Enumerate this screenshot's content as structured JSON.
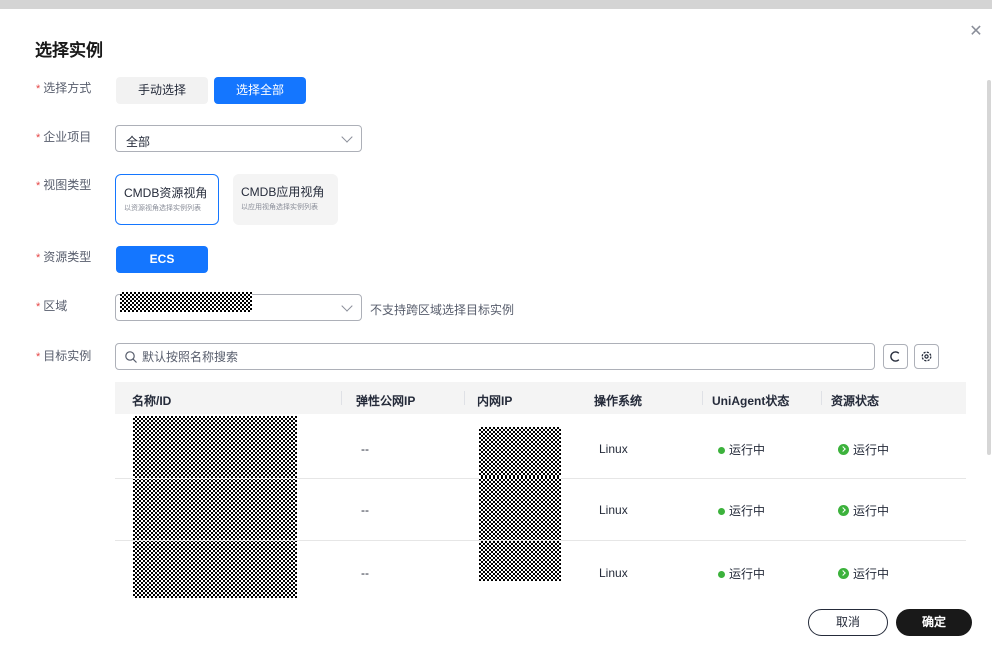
{
  "dialog": {
    "title": "选择实例",
    "close_icon": "close-icon"
  },
  "form": {
    "required_mark": "*",
    "select_method": {
      "label": "选择方式",
      "options": [
        "手动选择",
        "选择全部"
      ],
      "selected": "选择全部"
    },
    "enterprise_project": {
      "label": "企业项目",
      "value": "全部"
    },
    "view_type": {
      "label": "视图类型",
      "cards": [
        {
          "title": "CMDB资源视角",
          "subtitle": "以资源视角选择实例列表",
          "selected": true
        },
        {
          "title": "CMDB应用视角",
          "subtitle": "以应用视角选择实例列表",
          "selected": false
        }
      ]
    },
    "resource_type": {
      "label": "资源类型",
      "value": "ECS"
    },
    "region": {
      "label": "区域",
      "value_redacted": true,
      "hint": "不支持跨区域选择目标实例"
    },
    "target_instance": {
      "label": "目标实例",
      "search_placeholder": "默认按照名称搜索"
    }
  },
  "table": {
    "columns": [
      "名称/ID",
      "弹性公网IP",
      "内网IP",
      "操作系统",
      "UniAgent状态",
      "资源状态"
    ],
    "rows": [
      {
        "name_redacted": true,
        "eip": "--",
        "private_ip_redacted": true,
        "os": "Linux",
        "uniagent_status": "运行中",
        "resource_status": "运行中"
      },
      {
        "name_redacted": true,
        "eip": "--",
        "private_ip_redacted": true,
        "os": "Linux",
        "uniagent_status": "运行中",
        "resource_status": "运行中"
      },
      {
        "name_redacted": true,
        "eip": "--",
        "private_ip_redacted": true,
        "os": "Linux",
        "uniagent_status": "运行中",
        "resource_status": "运行中"
      }
    ]
  },
  "footer": {
    "cancel": "取消",
    "confirm": "确定"
  },
  "colors": {
    "primary": "#1476ff",
    "dark": "#191919",
    "success": "#3cb23c",
    "required": "#e54545"
  }
}
